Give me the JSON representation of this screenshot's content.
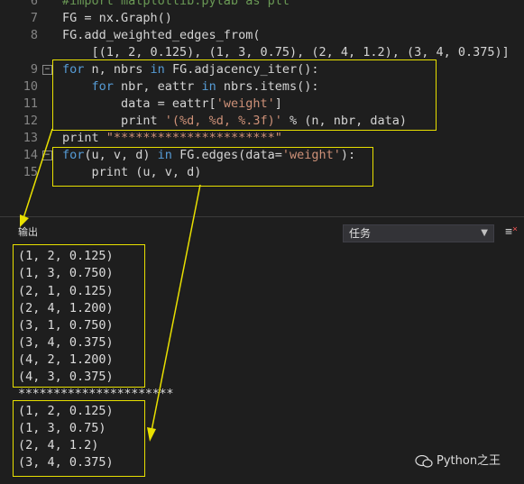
{
  "editor": {
    "line_numbers": [
      "6",
      "7",
      "8",
      "9",
      "10",
      "11",
      "12",
      "13",
      "14",
      "15"
    ],
    "lines": {
      "l6_cm": "#import matplotlib.pylab as plt",
      "l7": "FG = nx.Graph()",
      "l8": "FG.add_weighted_edges_from(",
      "l9": "    [(1, 2, 0.125), (1, 3, 0.75), (2, 4, 1.2), (3, 4, 0.375)]",
      "l10_kw1": "for",
      "l10_a": " n, nbrs ",
      "l10_kw2": "in",
      "l10_b": " FG.adjacency_iter():",
      "l11_ind": "    ",
      "l11_kw1": "for",
      "l11_a": " nbr, eattr ",
      "l11_kw2": "in",
      "l11_b": " nbrs.items():",
      "l12_a": "        data = eattr[",
      "l12_str": "'weight'",
      "l12_b": "]",
      "l13_a": "        print ",
      "l13_str": "'(%d, %d, %.3f)'",
      "l13_b": " % (n, nbr, data)",
      "l14_a": "print ",
      "l14_str": "\"**********************\"",
      "l15_kw1": "for",
      "l15_a": "(u, v, d) ",
      "l15_kw2": "in",
      "l15_b": " FG.edges(data=",
      "l15_str": "'weight'",
      "l15_c": "):",
      "l16": "    print (u, v, d)"
    }
  },
  "panel": {
    "title": "输出",
    "dropdown_value": "任务",
    "caret_icon": "▼",
    "clear_icon": "≡"
  },
  "output": {
    "block1": [
      "(1, 2, 0.125)",
      "(1, 3, 0.750)",
      "(2, 1, 0.125)",
      "(2, 4, 1.200)",
      "(3, 1, 0.750)",
      "(3, 4, 0.375)",
      "(4, 2, 1.200)",
      "(4, 3, 0.375)"
    ],
    "separator": "**********************",
    "block2": [
      "(1, 2, 0.125)",
      "(1, 3, 0.75)",
      "(2, 4, 1.2)",
      "(3, 4, 0.375)"
    ]
  },
  "watermark": "Python之王",
  "colors": {
    "highlight": "#e8e000",
    "keyword": "#569cd6",
    "string": "#ce9178",
    "comment": "#6a9955"
  }
}
